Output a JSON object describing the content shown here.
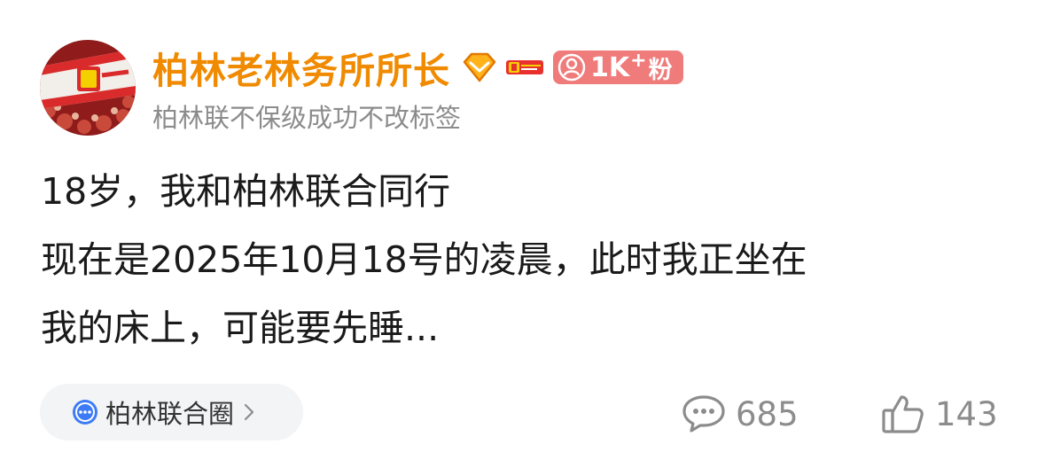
{
  "user": {
    "name": "柏林老林务所所长",
    "bio": "柏林联不保级成功不改标签",
    "fans": {
      "count": "1K",
      "plus": "+",
      "label": "粉"
    }
  },
  "post": {
    "lines": [
      "18岁，我和柏林联合同行",
      "现在是2025年10月18号的凌晨，此时我正坐在",
      "我的床上，可能要先睡..."
    ]
  },
  "topic": {
    "label": "柏林联合圈"
  },
  "stats": {
    "comments": "685",
    "likes": "143"
  },
  "colors": {
    "username": "#F08A00",
    "fans_badge": "#F07B7B",
    "bio": "#8C8C8C",
    "topic_icon": "#3D7BF5"
  }
}
